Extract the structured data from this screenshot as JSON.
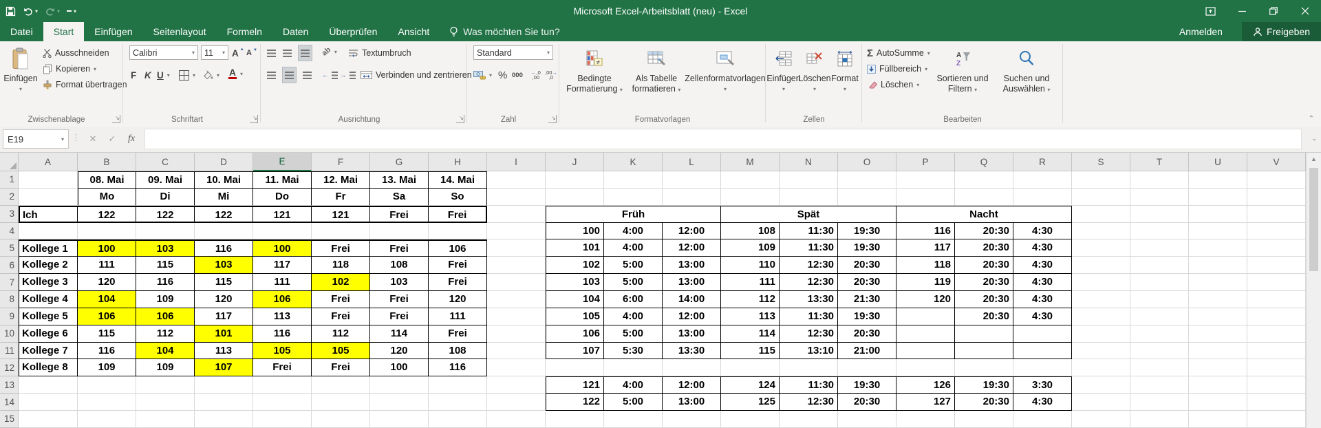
{
  "title_bar": {
    "title": "Microsoft Excel-Arbeitsblatt (neu) - Excel"
  },
  "tabs": [
    {
      "label": "Datei",
      "active": false
    },
    {
      "label": "Start",
      "active": true
    },
    {
      "label": "Einfügen",
      "active": false
    },
    {
      "label": "Seitenlayout",
      "active": false
    },
    {
      "label": "Formeln",
      "active": false
    },
    {
      "label": "Daten",
      "active": false
    },
    {
      "label": "Überprüfen",
      "active": false
    },
    {
      "label": "Ansicht",
      "active": false
    }
  ],
  "tell_me": "Was möchten Sie tun?",
  "account": {
    "sign_in": "Anmelden",
    "share": "Freigeben"
  },
  "colors": {
    "excel_green": "#217346",
    "highlight_yellow": "#ffff00"
  },
  "ribbon": {
    "clipboard": {
      "group": "Zwischenablage",
      "paste": "Einfügen",
      "cut": "Ausschneiden",
      "copy": "Kopieren",
      "painter": "Format übertragen"
    },
    "font": {
      "group": "Schriftart",
      "name": "Calibri",
      "size": "11",
      "bold": "F",
      "italic": "K",
      "underline": "U"
    },
    "alignment": {
      "group": "Ausrichtung",
      "wrap": "Textumbruch",
      "merge": "Verbinden und zentrieren"
    },
    "number": {
      "group": "Zahl",
      "format": "Standard",
      "percent": "%",
      "thousand": "000"
    },
    "styles": {
      "group": "Formatvorlagen",
      "conditional1": "Bedingte",
      "conditional2": "Formatierung",
      "as_table1": "Als Tabelle",
      "as_table2": "formatieren",
      "cell_styles": "Zellenformatvorlagen"
    },
    "cells": {
      "group": "Zellen",
      "insert": "Einfügen",
      "delete": "Löschen",
      "format": "Format"
    },
    "editing": {
      "group": "Bearbeiten",
      "autosum": "AutoSumme",
      "fill": "Füllbereich",
      "clear": "Löschen",
      "sort1": "Sortieren und",
      "sort2": "Filtern",
      "find1": "Suchen und",
      "find2": "Auswählen"
    }
  },
  "formula_bar": {
    "name_box": "E19",
    "fx": "fx",
    "content": ""
  },
  "sheet": {
    "columns": [
      "A",
      "B",
      "C",
      "D",
      "E",
      "F",
      "G",
      "H",
      "I",
      "J",
      "K",
      "L",
      "M",
      "N",
      "O",
      "P",
      "Q",
      "R",
      "S",
      "T",
      "U",
      "V"
    ],
    "selected_column": "E",
    "row_count": 15,
    "left_table": {
      "dates": [
        "08. Mai",
        "09. Mai",
        "10. Mai",
        "11. Mai",
        "12. Mai",
        "13. Mai",
        "14. Mai"
      ],
      "days": [
        "Mo",
        "Di",
        "Mi",
        "Do",
        "Fr",
        "Sa",
        "So"
      ],
      "me": {
        "label": "Ich",
        "values": [
          "122",
          "122",
          "122",
          "121",
          "121",
          "Frei",
          "Frei"
        ]
      },
      "colleagues": [
        {
          "label": "Kollege 1",
          "values": [
            "100",
            "103",
            "116",
            "100",
            "Frei",
            "Frei",
            "106"
          ],
          "highlighted": [
            0,
            1,
            3
          ]
        },
        {
          "label": "Kollege 2",
          "values": [
            "111",
            "115",
            "103",
            "117",
            "118",
            "108",
            "Frei"
          ],
          "highlighted": [
            2
          ]
        },
        {
          "label": "Kollege 3",
          "values": [
            "120",
            "116",
            "115",
            "111",
            "102",
            "103",
            "Frei"
          ],
          "highlighted": [
            4
          ]
        },
        {
          "label": "Kollege 4",
          "values": [
            "104",
            "109",
            "120",
            "106",
            "Frei",
            "Frei",
            "120"
          ],
          "highlighted": [
            0,
            3
          ]
        },
        {
          "label": "Kollege 5",
          "values": [
            "106",
            "106",
            "117",
            "113",
            "Frei",
            "Frei",
            "111"
          ],
          "highlighted": [
            0,
            1
          ]
        },
        {
          "label": "Kollege 6",
          "values": [
            "115",
            "112",
            "101",
            "116",
            "112",
            "114",
            "Frei"
          ],
          "highlighted": [
            2
          ]
        },
        {
          "label": "Kollege 7",
          "values": [
            "116",
            "104",
            "113",
            "105",
            "105",
            "120",
            "108"
          ],
          "highlighted": [
            1,
            3,
            4
          ]
        },
        {
          "label": "Kollege 8",
          "values": [
            "109",
            "109",
            "107",
            "Frei",
            "Frei",
            "100",
            "116"
          ],
          "highlighted": [
            2
          ]
        }
      ]
    },
    "right_table": {
      "shift_headers": [
        "Früh",
        "Spät",
        "Nacht"
      ],
      "shift_rows": [
        [
          "100",
          "4:00",
          "12:00",
          "108",
          "11:30",
          "19:30",
          "116",
          "20:30",
          "4:30"
        ],
        [
          "101",
          "4:00",
          "12:00",
          "109",
          "11:30",
          "19:30",
          "117",
          "20:30",
          "4:30"
        ],
        [
          "102",
          "5:00",
          "13:00",
          "110",
          "12:30",
          "20:30",
          "118",
          "20:30",
          "4:30"
        ],
        [
          "103",
          "5:00",
          "13:00",
          "111",
          "12:30",
          "20:30",
          "119",
          "20:30",
          "4:30"
        ],
        [
          "104",
          "6:00",
          "14:00",
          "112",
          "13:30",
          "21:30",
          "120",
          "20:30",
          "4:30"
        ],
        [
          "105",
          "4:00",
          "12:00",
          "113",
          "11:30",
          "19:30",
          "",
          "20:30",
          "4:30"
        ],
        [
          "106",
          "5:00",
          "13:00",
          "114",
          "12:30",
          "20:30",
          "",
          "",
          ""
        ],
        [
          "107",
          "5:30",
          "13:30",
          "115",
          "13:10",
          "21:00",
          "",
          "",
          ""
        ]
      ],
      "extra_rows": [
        [
          "121",
          "4:00",
          "12:00",
          "124",
          "11:30",
          "19:30",
          "126",
          "19:30",
          "3:30"
        ],
        [
          "122",
          "5:00",
          "13:00",
          "125",
          "12:30",
          "20:30",
          "127",
          "20:30",
          "4:30"
        ]
      ]
    }
  }
}
